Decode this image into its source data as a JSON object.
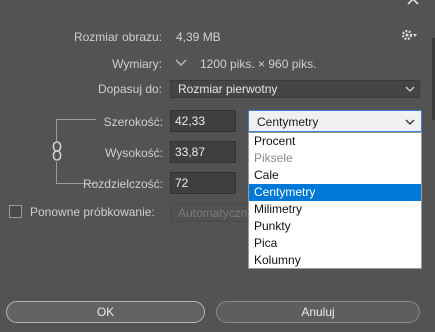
{
  "image_size": {
    "label": "Rozmiar obrazu:",
    "value": "4,39 MB"
  },
  "dimensions": {
    "label": "Wymiary:",
    "value": "1200 piks. × 960 piks."
  },
  "fit_to": {
    "label": "Dopasuj do:",
    "value": "Rozmiar pierwotny"
  },
  "width": {
    "label": "Szerokość:",
    "value": "42,33"
  },
  "height": {
    "label": "Wysokość:",
    "value": "33,87"
  },
  "resolution": {
    "label": "Rozdzielczość:",
    "value": "72"
  },
  "unit": {
    "selected": "Centymetry",
    "options": [
      "Procent",
      "Piksele",
      "Cale",
      "Centymetry",
      "Milimetry",
      "Punkty",
      "Pica",
      "Kolumny"
    ]
  },
  "resample": {
    "label": "Ponowne próbkowanie:",
    "value": "Automatyczne"
  },
  "buttons": {
    "ok": "OK",
    "cancel": "Anuluj"
  },
  "icons": {
    "settings": "gear-icon",
    "dimensions": "check-icon",
    "link": "chain-link-icon",
    "dropdown": "chevron-down-icon",
    "close": "close-icon"
  },
  "colors": {
    "background": "#535353",
    "selection": "#0078d7",
    "dropdown_bg": "#ffffff"
  }
}
